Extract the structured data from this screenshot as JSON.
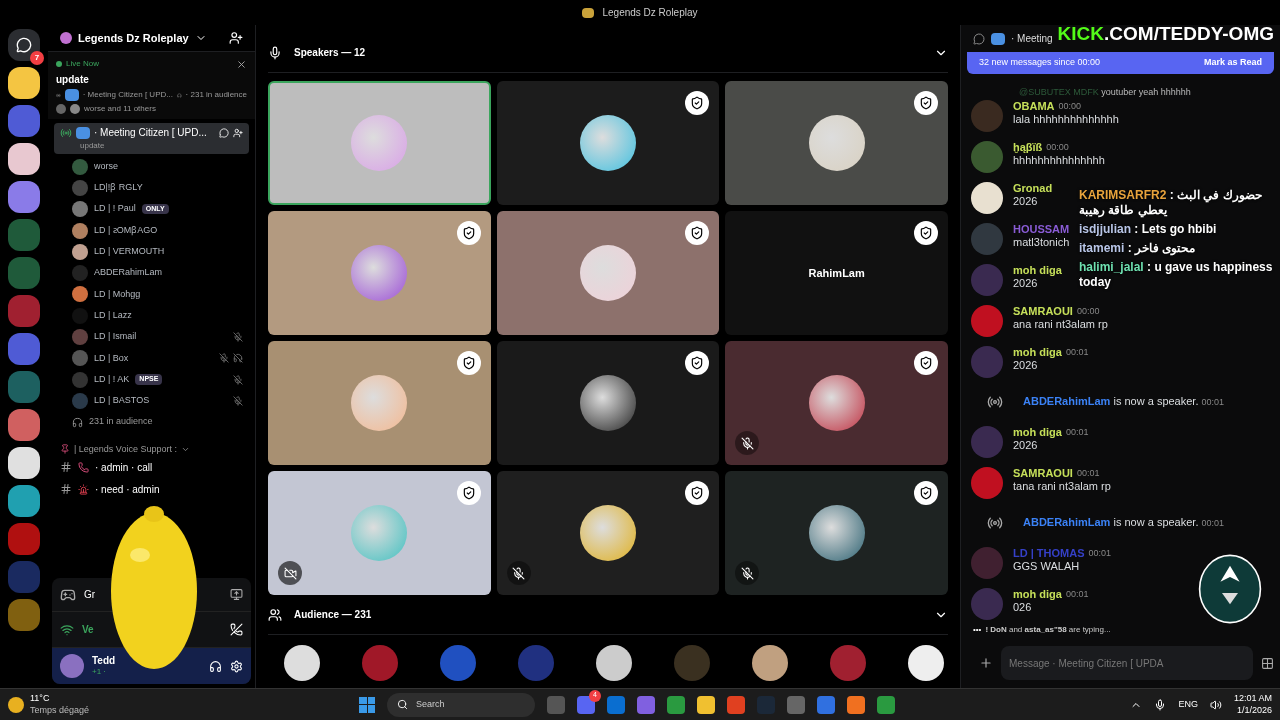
{
  "window": {
    "title": "Legends Dz Roleplay"
  },
  "server_rail": {
    "badge": "7"
  },
  "sidebar": {
    "server_name": "Legends Dz Roleplay",
    "live_card": {
      "status": "Live Now",
      "title": "update",
      "channel": "· Meeting Citizen [ UPD...",
      "audience": "· 231 in audience",
      "people": "worse and 11 others"
    },
    "stage_channel": {
      "name": "· Meeting Citizen [ UPD...",
      "topic": "update",
      "selected": true
    },
    "members": [
      {
        "name": "worse",
        "muted": false,
        "deafened": false
      },
      {
        "name": "LD|!ꞵ RGLY",
        "muted": false,
        "deafened": false
      },
      {
        "name": "LD | ! Paul",
        "tag": "ONLY",
        "muted": false,
        "deafened": false
      },
      {
        "name": "LD | ꙅOMꞵAGO",
        "muted": false,
        "deafened": false
      },
      {
        "name": "LD | VERMOUTH",
        "muted": false,
        "deafened": false
      },
      {
        "name": "ABDERahimLam",
        "muted": false,
        "deafened": false
      },
      {
        "name": "LD | Mohgg",
        "muted": false,
        "deafened": false
      },
      {
        "name": "LD | Lazz",
        "muted": false,
        "deafened": false
      },
      {
        "name": "LD | Ismail",
        "muted": true,
        "deafened": false
      },
      {
        "name": "LD | Box",
        "muted": true,
        "deafened": true
      },
      {
        "name": "LD | ! AK",
        "tag": "NPSE",
        "muted": true,
        "deafened": false
      },
      {
        "name": "LD | BASTOS",
        "muted": true,
        "deafened": false
      }
    ],
    "audience": "231 in audience",
    "category": "| Legends Voice Support :",
    "channels": [
      "· admin · call",
      "· need · admin"
    ],
    "panel": {
      "game": "Gr",
      "voice": "Ve",
      "user": "Tedd",
      "user_status": "+1 ·"
    }
  },
  "stage": {
    "speakers_heading": "Speakers — 12",
    "tiles": [
      {
        "speaking": true,
        "badge": false,
        "muted": false,
        "camera_off": false
      },
      {
        "speaking": false,
        "badge": true,
        "muted": false,
        "camera_off": false
      },
      {
        "speaking": false,
        "badge": true,
        "muted": false,
        "camera_off": false
      },
      {
        "speaking": false,
        "badge": true,
        "muted": false,
        "camera_off": false
      },
      {
        "speaking": false,
        "badge": true,
        "muted": false,
        "camera_off": false
      },
      {
        "speaking": false,
        "badge": true,
        "muted": false,
        "camera_off": false,
        "label": "RahimLam"
      },
      {
        "speaking": false,
        "badge": true,
        "muted": false,
        "camera_off": false
      },
      {
        "speaking": false,
        "badge": true,
        "muted": false,
        "camera_off": false
      },
      {
        "speaking": false,
        "badge": true,
        "muted": true,
        "camera_off": false
      },
      {
        "speaking": false,
        "badge": true,
        "muted": false,
        "camera_off": true
      },
      {
        "speaking": false,
        "badge": true,
        "muted": true,
        "camera_off": false
      },
      {
        "speaking": false,
        "badge": true,
        "muted": true,
        "camera_off": false
      }
    ],
    "audience_heading": "Audience — 231"
  },
  "chat": {
    "title": "· Meeting",
    "new_messages": "32 new messages since 00:00",
    "mark_read": "Mark as Read",
    "messages": [
      {
        "kind": "message",
        "reply_user": "@SUBUTEX MDFK",
        "reply_text": "youtuber yeah hhhhhh",
        "user": "OBAMA",
        "color": "#c6e05a",
        "time": "00:00",
        "text": "lala hhhhhhhhhhhhhh"
      },
      {
        "kind": "message",
        "user": "ḫąβïß",
        "color": "#c6e05a",
        "time": "00:00",
        "text": "hhhhhhhhhhhhhhh"
      },
      {
        "kind": "message",
        "user": "Gronad",
        "color": "#c6e05a",
        "text": "2026"
      },
      {
        "kind": "message",
        "user": "HOUSSAM",
        "color": "#8a5cd6",
        "text": "matl3tonich"
      },
      {
        "kind": "message",
        "user": "moh diga",
        "color": "#c6e05a",
        "text": "2026"
      },
      {
        "kind": "message",
        "user": "SAMRAOUI",
        "color": "#c6e05a",
        "time": "00:00",
        "text": "ana rani nt3alam rp"
      },
      {
        "kind": "message",
        "user": "moh diga",
        "color": "#c6e05a",
        "time": "00:01",
        "text": "2026"
      },
      {
        "kind": "system",
        "user": "ABDERahimLam",
        "color": "#3b82f6",
        "text": "is now a speaker.",
        "time": "00:01"
      },
      {
        "kind": "message",
        "user": "moh diga",
        "color": "#c6e05a",
        "time": "00:01",
        "text": "2026"
      },
      {
        "kind": "message",
        "user": "SAMRAOUI",
        "color": "#c6e05a",
        "time": "00:01",
        "text": "tana rani nt3alam rp"
      },
      {
        "kind": "system",
        "user": "ABDERahimLam",
        "color": "#3b82f6",
        "text": "is now a speaker.",
        "time": "00:01"
      },
      {
        "kind": "message",
        "user": "LD | THOMAS",
        "color": "#3540c8",
        "time": "00:01",
        "text": "GGS WALAH"
      },
      {
        "kind": "message",
        "user": "moh diga",
        "color": "#c6e05a",
        "time": "00:01",
        "text": "026"
      }
    ],
    "typing": {
      "dots": "•••",
      "first": "! DoN",
      "and": "and",
      "second": "asta_as\"58",
      "suffix": "are typing..."
    },
    "placeholder": "Message · Meeting Citizen [ UPDA"
  },
  "overlay": {
    "banner_a": "KICK",
    "banner_b": ".COM/TEDDY-OMG",
    "lines": [
      {
        "user": "KARIMSARFR2",
        "color": "#e8a33c",
        "text": ": حضورك في البث يعطي طاقة رهيبة"
      },
      {
        "user": "isdjjulian",
        "color": "#b9c6e8",
        "text": ": Lets go hbibi"
      },
      {
        "user": "itamemi",
        "color": "#b9c6e8",
        "text": ": محتوى فاخر"
      },
      {
        "user": "halimi_jalal",
        "color": "#6ee0b0",
        "text": ": u gave us happiness today"
      }
    ]
  },
  "taskbar": {
    "temp": "11°C",
    "weather": "Temps dégagé",
    "search": "Search",
    "discord_badge": "4",
    "lang": "ENG",
    "time": "12:01 AM",
    "date": "1/1/2026"
  }
}
